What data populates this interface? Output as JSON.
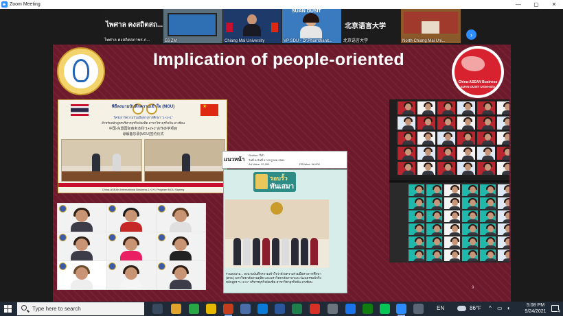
{
  "window": {
    "title": "Zoom Meeting",
    "minimize": "—",
    "maximize": "▢",
    "close": "✕"
  },
  "gallery": {
    "participants": [
      {
        "name": "ไพศาล คงสถิตสภาพร-ก...",
        "big_label": "ไพศาล คงสถิตสถ..."
      },
      {
        "name": "E6 ZM",
        "big_label": ""
      },
      {
        "name": "Chiang Mai University",
        "big_label": ""
      },
      {
        "name": "VP SDU - Dr.Phornthanit...",
        "big_label": "SUAN DUSIT"
      },
      {
        "name": "北京语言大学",
        "big_label": "北京语言大学"
      },
      {
        "name": "North-Chiang Mai Uni...",
        "big_label": ""
      }
    ],
    "next_arrow": "›"
  },
  "slide": {
    "title": "Implication of people-oriented",
    "logo_right_line1": "China-ASEAN Business",
    "logo_right_line2": "SUAN DUSIT University",
    "mou": {
      "thai_title": "พิธีลงนามบันทึกความเข้าใจ (MOU)",
      "thai_sub": "โครงการความร่วมมือทางการศึกษา \"1+2+1\"",
      "line3": "สำหรับหลักสูตรบริหารธุรกิจบัณฑิต สาขาวิชาธุรกิจจีน-อาเซียน",
      "cn_line1": "中国-东盟国际商务本科\"1+2+1\"合作办学项目",
      "cn_line2": "谅解备忘录(MOU)签约仪式",
      "footer": "China-ASEAN International Business 1+2+1 Program MOU Signing"
    },
    "news": {
      "brand": "แนวหน้า",
      "date_label": "วันที่ ลงวันที่ 9 กรกฎาคม 2564",
      "meta1": "Section: กีฬา",
      "meta2": "Ad Value: 32,000",
      "meta3": "PRValue: 96,000"
    },
    "clip": {
      "banner_top": "รอบรั้ว",
      "banner_bottom": "ทันเสมา",
      "caption": "ร่วมลงนาม... ลงนามบันทึกความเข้าใจว่าด้วยความร่วมมือทางการศึกษา (สกอ.) มหาวิทยาลัยสวนดุสิต และมหาวิทยาลัยภาษาและวัฒนธรรมปักกิ่ง หลักสูตร \"1+2+1\" บริหารธุรกิจบัณฑิต สาขาวิชาธุรกิจจีน-อาเซียน"
    },
    "page_number": "9"
  },
  "taskbar": {
    "search_placeholder": "Type here to search",
    "language": "EN",
    "weather": "86°F",
    "time": "5:08 PM",
    "date": "9/24/2021",
    "notifications": "4"
  }
}
